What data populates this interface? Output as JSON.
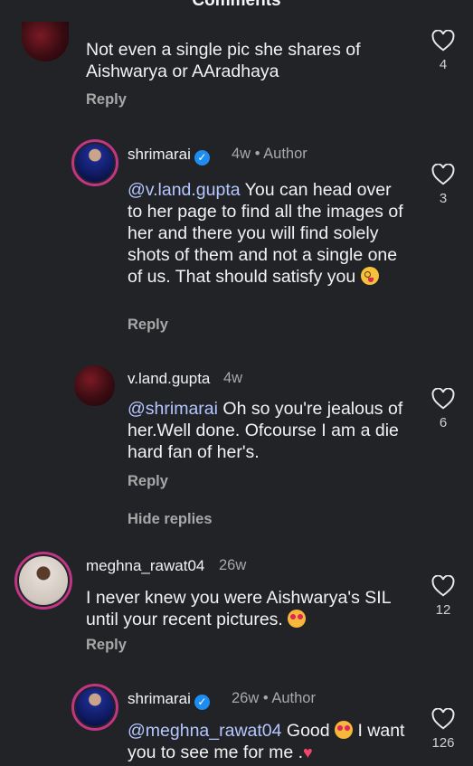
{
  "header": {
    "title": "Comments"
  },
  "comments": [
    {
      "text": "Not even a single pic she shares of Aishwarya or AAradhaya",
      "reply_label": "Reply",
      "likes": "4"
    },
    {
      "username": "shrimarai",
      "time": "4w",
      "separator": "•",
      "tag": "Author",
      "mention": "@v.land.gupta",
      "text": " You can head over to her page to find all the images of her and there you will find solely shots of them and not a single one of us. That should satisfy you ",
      "emoji": "dizzy-face",
      "reply_label": "Reply",
      "likes": "3"
    },
    {
      "username": "v.land.gupta",
      "time": "4w",
      "mention": "@shrimarai",
      "text": " Oh so you're jealous of her.Well done.  Ofcourse I am a die hard fan of her's.",
      "reply_label": "Reply",
      "likes": "6"
    },
    {
      "hide_replies_label": "Hide replies"
    },
    {
      "username": "meghna_rawat04",
      "time": "26w",
      "text": "I never knew you were Aishwarya's SIL until your recent pictures. ",
      "emoji": "heart-eyes",
      "reply_label": "Reply",
      "likes": "12"
    },
    {
      "username": "shrimarai",
      "time": "26w",
      "separator": "•",
      "tag": "Author",
      "mention": "@meghna_rawat04",
      "text_a": " Good ",
      "text_b": " I want you to see me for me .",
      "emoji": "heart-eyes",
      "likes": "126"
    }
  ],
  "colors": {
    "background": "#212327",
    "mention": "#b5c7ff",
    "verified": "#1f8cf0",
    "story_ring": "#c13584"
  }
}
